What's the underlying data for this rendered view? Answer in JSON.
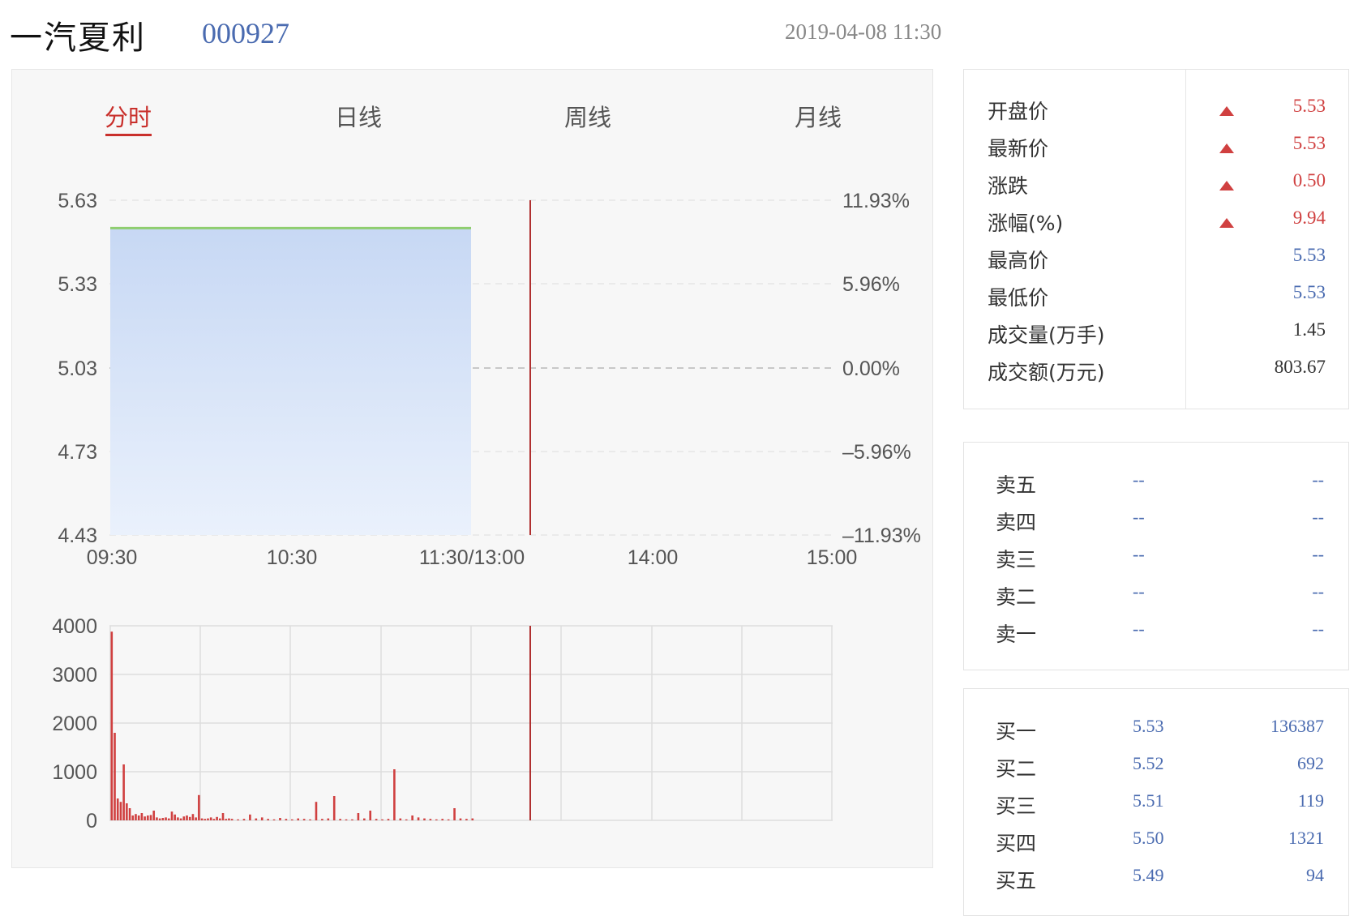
{
  "header": {
    "name": "一汽夏利",
    "code": "000927",
    "datetime": "2019-04-08 11:30"
  },
  "tabs": [
    {
      "label": "分时",
      "active": true
    },
    {
      "label": "日线",
      "active": false
    },
    {
      "label": "周线",
      "active": false
    },
    {
      "label": "月线",
      "active": false
    }
  ],
  "colors": {
    "up": "#d04040",
    "price_fill_top": "#c7d8f4",
    "price_line": "#8fce6f",
    "accent": "#c9302c",
    "link": "#4a6bb0"
  },
  "chart_data": [
    {
      "type": "area",
      "y_left_ticks": [
        "5.63",
        "5.33",
        "5.03",
        "4.73",
        "4.43"
      ],
      "y_right_ticks": [
        "11.93%",
        "5.96%",
        "0.00%",
        "–5.96%",
        "–11.93%"
      ],
      "x_ticks": [
        "09:30",
        "10:30",
        "11:30/13:00",
        "14:00",
        "15:00"
      ],
      "ylim": [
        4.43,
        5.63
      ],
      "prev_close": 5.03,
      "series": [
        {
          "x": [
            "09:30",
            "11:30"
          ],
          "values": [
            5.53,
            5.53
          ]
        }
      ]
    },
    {
      "type": "bar",
      "y_ticks": [
        "4000",
        "3000",
        "2000",
        "1000",
        "0"
      ],
      "ylim": [
        0,
        4000
      ],
      "x_minutes_from_open": [
        0,
        1,
        2,
        3,
        4,
        5,
        6,
        7,
        8,
        9,
        10,
        11,
        12,
        13,
        14,
        15,
        16,
        17,
        18,
        19,
        20,
        21,
        22,
        23,
        24,
        25,
        26,
        27,
        28,
        29,
        30,
        31,
        32,
        33,
        34,
        35,
        36,
        37,
        38,
        39,
        40,
        42,
        44,
        46,
        48,
        50,
        52,
        54,
        56,
        58,
        60,
        62,
        64,
        66,
        68,
        70,
        72,
        74,
        76,
        78,
        80,
        82,
        84,
        86,
        88,
        90,
        92,
        94,
        96,
        98,
        100,
        102,
        104,
        106,
        108,
        110,
        112,
        114,
        116,
        118,
        120
      ],
      "values": [
        3880,
        1800,
        450,
        380,
        1150,
        350,
        250,
        100,
        130,
        100,
        150,
        80,
        100,
        110,
        200,
        60,
        40,
        50,
        60,
        40,
        180,
        120,
        60,
        40,
        80,
        100,
        70,
        130,
        60,
        520,
        40,
        30,
        40,
        60,
        30,
        70,
        40,
        150,
        30,
        40,
        30,
        20,
        30,
        120,
        40,
        60,
        30,
        20,
        50,
        30,
        20,
        40,
        30,
        20,
        380,
        30,
        40,
        500,
        30,
        20,
        20,
        150,
        40,
        200,
        30,
        20,
        30,
        1050,
        40,
        20,
        100,
        60,
        40,
        30,
        20,
        30,
        20,
        250,
        40,
        30,
        40
      ]
    }
  ],
  "quote": [
    {
      "label": "开盘价",
      "value": "5.53",
      "color": "#d04040",
      "arrow": true
    },
    {
      "label": "最新价",
      "value": "5.53",
      "color": "#d04040",
      "arrow": true
    },
    {
      "label": "涨跌",
      "value": "0.50",
      "color": "#d04040",
      "arrow": true
    },
    {
      "label": "涨幅(%)",
      "value": "9.94",
      "color": "#d04040",
      "arrow": true
    },
    {
      "label": "最高价",
      "value": "5.53",
      "color": "#4a6bb0",
      "arrow": false
    },
    {
      "label": "最低价",
      "value": "5.53",
      "color": "#4a6bb0",
      "arrow": false
    },
    {
      "label": "成交量(万手)",
      "value": "1.45",
      "color": "#333333",
      "arrow": false
    },
    {
      "label": "成交额(万元)",
      "value": "803.67",
      "color": "#333333",
      "arrow": false
    }
  ],
  "asks": [
    {
      "label": "卖五",
      "price": "--",
      "volume": "--"
    },
    {
      "label": "卖四",
      "price": "--",
      "volume": "--"
    },
    {
      "label": "卖三",
      "price": "--",
      "volume": "--"
    },
    {
      "label": "卖二",
      "price": "--",
      "volume": "--"
    },
    {
      "label": "卖一",
      "price": "--",
      "volume": "--"
    }
  ],
  "bids": [
    {
      "label": "买一",
      "price": "5.53",
      "volume": "136387"
    },
    {
      "label": "买二",
      "price": "5.52",
      "volume": "692"
    },
    {
      "label": "买三",
      "price": "5.51",
      "volume": "119"
    },
    {
      "label": "买四",
      "price": "5.50",
      "volume": "1321"
    },
    {
      "label": "买五",
      "price": "5.49",
      "volume": "94"
    }
  ]
}
